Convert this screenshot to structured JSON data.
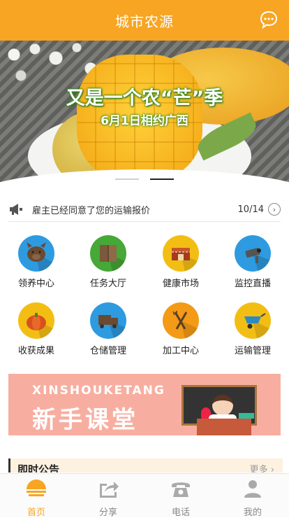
{
  "header": {
    "title": "城市农源",
    "chat_icon": "chat-bubble-icon"
  },
  "banner": {
    "title": "又是一个农“芒”季",
    "subtitle": "6月1日相约广西",
    "slides_total": 2,
    "active_slide": 2
  },
  "notice": {
    "icon": "megaphone-icon",
    "text": "雇主已经同意了您的运输报价",
    "count": "10/14"
  },
  "features": [
    {
      "label": "领养中心",
      "icon": "pig-icon",
      "color": "#2e9be0"
    },
    {
      "label": "任务大厅",
      "icon": "book-icon",
      "color": "#46a836"
    },
    {
      "label": "健康市场",
      "icon": "market-icon",
      "color": "#f3be14"
    },
    {
      "label": "监控直播",
      "icon": "camera-icon",
      "color": "#2e9be0"
    },
    {
      "label": "收获成果",
      "icon": "pumpkin-icon",
      "color": "#f3be14"
    },
    {
      "label": "仓储管理",
      "icon": "truck-icon",
      "color": "#2e9be0"
    },
    {
      "label": "加工中心",
      "icon": "fork-knife-icon",
      "color": "#f39a16"
    },
    {
      "label": "运输管理",
      "icon": "wheelbarrow-icon",
      "color": "#f3be14"
    }
  ],
  "promo": {
    "en": "XINSHOUKETANG",
    "cn": "新手课堂"
  },
  "announce": {
    "title": "即时公告",
    "more": "更多 ›"
  },
  "tabbar": [
    {
      "label": "首页",
      "icon": "home-sun-icon",
      "active": true
    },
    {
      "label": "分享",
      "icon": "share-icon",
      "active": false
    },
    {
      "label": "电话",
      "icon": "phone-icon",
      "active": false
    },
    {
      "label": "我的",
      "icon": "user-icon",
      "active": false
    }
  ],
  "colors": {
    "brand": "#f7a523",
    "promo_bg": "#f7aea0"
  }
}
